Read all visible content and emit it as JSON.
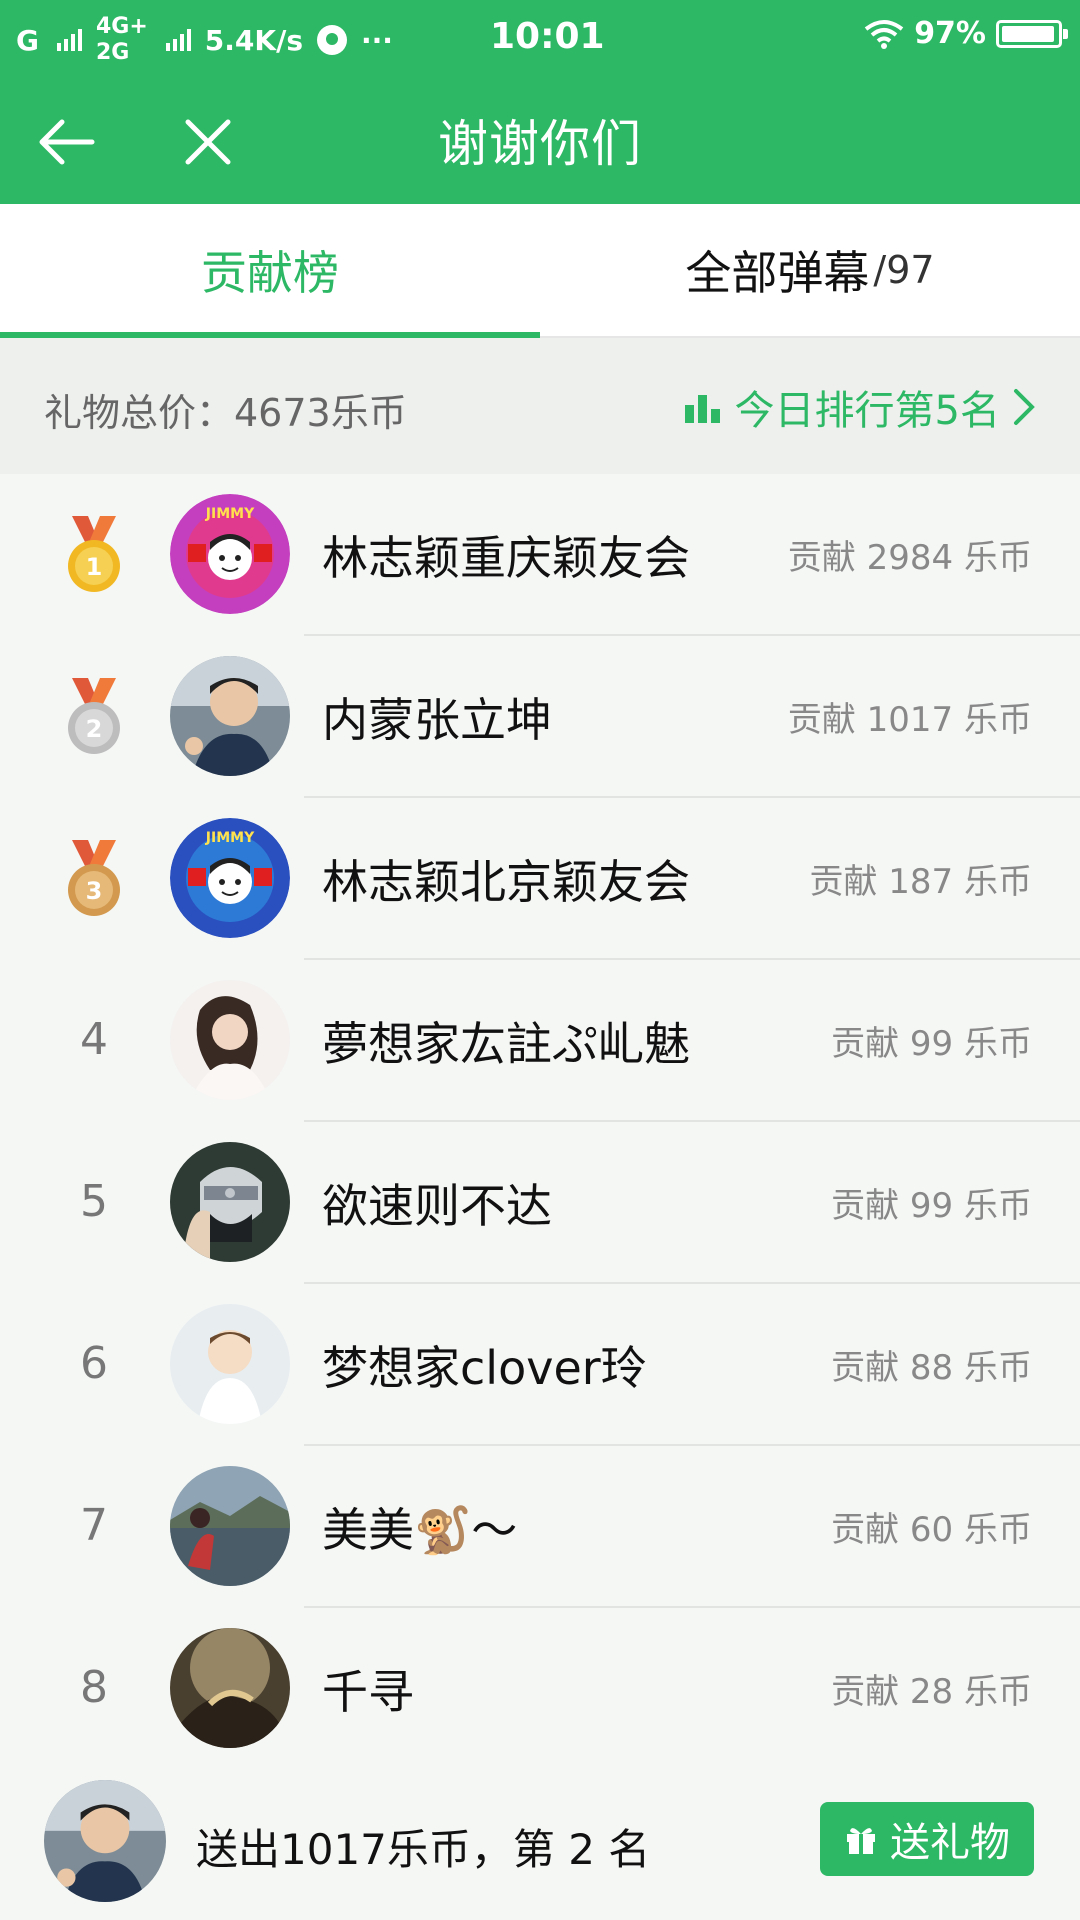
{
  "status_bar": {
    "carrier1": "G",
    "net_top": "4G+",
    "net_bottom": "2G",
    "speed": "5.4K/s",
    "dots": "···",
    "time": "10:01",
    "battery": "97%",
    "battery_level": 0.97
  },
  "header": {
    "title": "谢谢你们",
    "back_icon": "arrow-left-icon",
    "close_icon": "close-icon"
  },
  "tabs": [
    {
      "label": "贡献榜",
      "active": true
    },
    {
      "label": "全部弹幕",
      "count": "/97",
      "active": false
    }
  ],
  "summary": {
    "total_label": "礼物总价：4673乐币",
    "ranking_label": "今日排行第5名",
    "ranking_icon": "bar-chart-icon",
    "chevron_icon": "chevron-right-icon"
  },
  "list": [
    {
      "rank": "1",
      "medal": "gold",
      "name": "林志颖重庆颖友会",
      "contribution": "贡献 2984 乐币"
    },
    {
      "rank": "2",
      "medal": "silver",
      "name": "内蒙张立坤",
      "contribution": "贡献 1017 乐币"
    },
    {
      "rank": "3",
      "medal": "bronze",
      "name": "林志颖北京颖友会",
      "contribution": "贡献 187 乐币"
    },
    {
      "rank": "4",
      "medal": null,
      "name": "夢想家厷註ぷ乢魅",
      "contribution": "贡献 99 乐币"
    },
    {
      "rank": "5",
      "medal": null,
      "name": "欲速则不达",
      "contribution": "贡献 99 乐币"
    },
    {
      "rank": "6",
      "medal": null,
      "name": "梦想家clover玲",
      "contribution": "贡献 88 乐币"
    },
    {
      "rank": "7",
      "medal": null,
      "name": "美美🐒～",
      "contribution": "贡献 60 乐币"
    },
    {
      "rank": "8",
      "medal": null,
      "name": "千寻",
      "contribution": "贡献 28 乐币"
    }
  ],
  "footer": {
    "my_status": "送出1017乐币，第 2 名",
    "gift_button": "送礼物",
    "gift_icon": "gift-icon"
  },
  "colors": {
    "primary": "#2db865",
    "gold": "#f2b824",
    "silver": "#c8c8c8",
    "bronze": "#d9a45a"
  }
}
